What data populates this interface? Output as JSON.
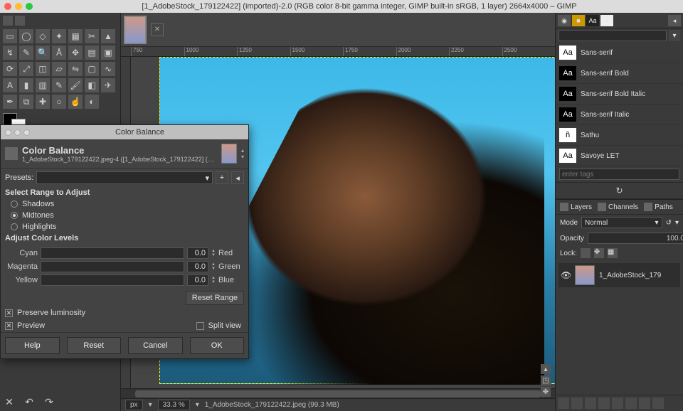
{
  "title": "[1_AdobeStock_179122422] (imported)-2.0 (RGB color 8-bit gamma integer, GIMP built-in sRGB, 1 layer) 2664x4000 – GIMP",
  "ruler_ticks": [
    "750",
    "1000",
    "1250",
    "1500",
    "1750",
    "2000",
    "2250",
    "2500"
  ],
  "statusbar": {
    "unit": "px",
    "zoom": "33.3 %",
    "file": "1_AdobeStock_179122422.jpeg (99.3 MB)"
  },
  "fonts": {
    "filter": "",
    "items": [
      {
        "sample": "Aa",
        "dark": false,
        "name": "Sans-serif"
      },
      {
        "sample": "Aa",
        "dark": true,
        "name": "Sans-serif Bold"
      },
      {
        "sample": "Aa",
        "dark": true,
        "name": "Sans-serif Bold Italic"
      },
      {
        "sample": "Aa",
        "dark": true,
        "name": "Sans-serif Italic"
      },
      {
        "sample": "ñ",
        "dark": false,
        "name": "Sathu"
      },
      {
        "sample": "Aa",
        "dark": false,
        "name": "Savoye LET"
      }
    ],
    "tags_placeholder": "enter tags"
  },
  "layers": {
    "tabs": [
      "Layers",
      "Channels",
      "Paths"
    ],
    "mode_label": "Mode",
    "mode": "Normal",
    "opacity_label": "Opacity",
    "opacity": "100.0",
    "lock_label": "Lock:",
    "layer_name": "1_AdobeStock_179"
  },
  "dialog": {
    "titlebar": "Color Balance",
    "header": "Color Balance",
    "sub": "1_AdobeStock_179122422.jpeg-4 ([1_AdobeStock_179122422] (…",
    "presets_label": "Presets:",
    "range_label": "Select Range to Adjust",
    "ranges": [
      "Shadows",
      "Midtones",
      "Highlights"
    ],
    "range_selected": 1,
    "adjust_label": "Adjust Color Levels",
    "sliders": [
      {
        "left": "Cyan",
        "val": "0.0",
        "right": "Red"
      },
      {
        "left": "Magenta",
        "val": "0.0",
        "right": "Green"
      },
      {
        "left": "Yellow",
        "val": "0.0",
        "right": "Blue"
      }
    ],
    "reset_range": "Reset Range",
    "preserve": "Preserve luminosity",
    "preview": "Preview",
    "split": "Split view",
    "buttons": [
      "Help",
      "Reset",
      "Cancel",
      "OK"
    ]
  }
}
